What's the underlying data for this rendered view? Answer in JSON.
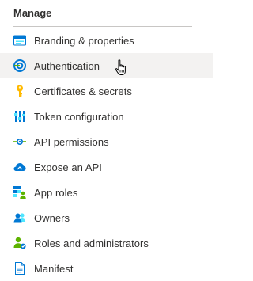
{
  "section": {
    "title": "Manage"
  },
  "menu": {
    "items": [
      {
        "label": "Branding & properties",
        "icon": "branding-icon"
      },
      {
        "label": "Authentication",
        "icon": "authentication-icon"
      },
      {
        "label": "Certificates & secrets",
        "icon": "key-icon"
      },
      {
        "label": "Token configuration",
        "icon": "token-config-icon"
      },
      {
        "label": "API permissions",
        "icon": "api-permissions-icon"
      },
      {
        "label": "Expose an API",
        "icon": "cloud-icon"
      },
      {
        "label": "App roles",
        "icon": "app-roles-icon"
      },
      {
        "label": "Owners",
        "icon": "owners-icon"
      },
      {
        "label": "Roles and administrators",
        "icon": "roles-admin-icon"
      },
      {
        "label": "Manifest",
        "icon": "manifest-icon"
      }
    ]
  },
  "colors": {
    "accent": "#0078d4",
    "hover_bg": "#f3f2f1",
    "key": "#ffb900",
    "green": "#5db300"
  }
}
